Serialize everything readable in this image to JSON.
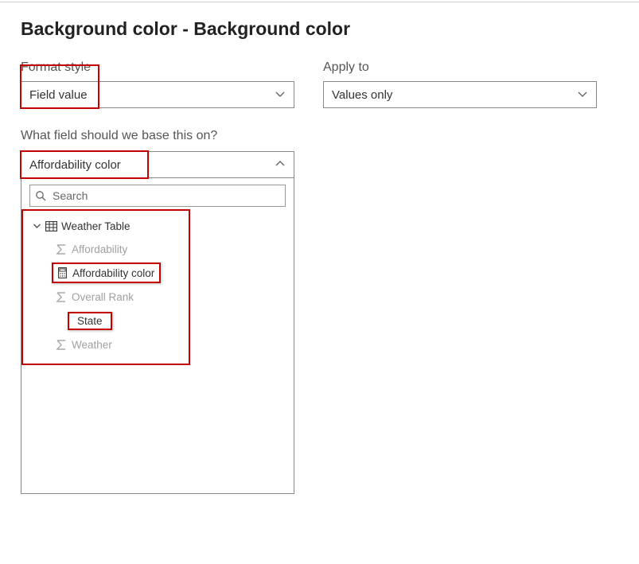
{
  "title": "Background color - Background color",
  "formatStyle": {
    "label": "Format style",
    "value": "Field value"
  },
  "applyTo": {
    "label": "Apply to",
    "value": "Values only"
  },
  "fieldQuestion": "What field should we base this on?",
  "fieldSelect": {
    "value": "Affordability color"
  },
  "search": {
    "placeholder": "Search"
  },
  "tree": {
    "tableName": "Weather Table",
    "items": [
      {
        "label": "Affordability",
        "iconType": "sigma",
        "muted": true
      },
      {
        "label": "Affordability color",
        "iconType": "calc",
        "muted": false
      },
      {
        "label": "Overall Rank",
        "iconType": "sigma",
        "muted": true
      },
      {
        "label": "State",
        "iconType": "none",
        "muted": false
      },
      {
        "label": "Weather",
        "iconType": "sigma",
        "muted": true
      }
    ]
  }
}
